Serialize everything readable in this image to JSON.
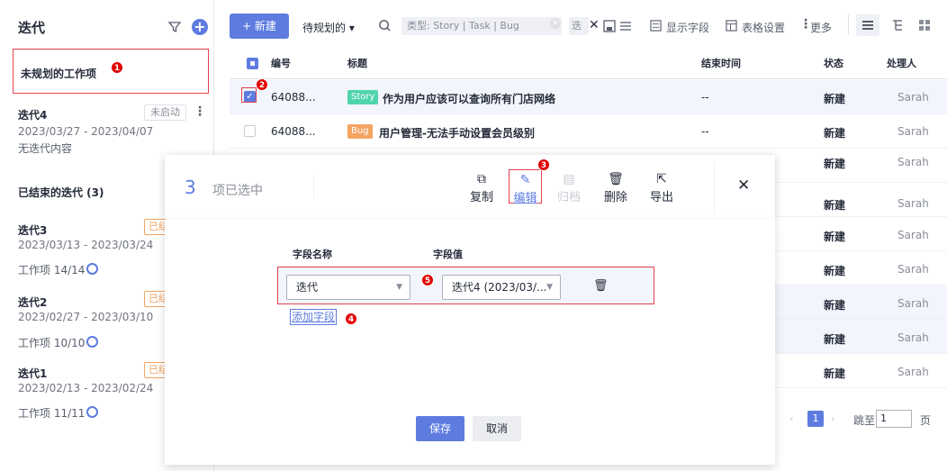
{
  "sidebar": {
    "title": "迭代",
    "unplanned": "未规划的工作项",
    "current": {
      "name": "迭代4",
      "status": "未启动",
      "dates": "2023/03/27 - 2023/04/07",
      "desc": "无迭代内容"
    },
    "ended_header": "已结束的迭代 (3)",
    "ended": [
      {
        "name": "迭代3",
        "tag": "已结",
        "dates": "2023/03/13 - 2023/03/24",
        "items": "工作项 14/14"
      },
      {
        "name": "迭代2",
        "tag": "已结",
        "dates": "2023/02/27 - 2023/03/10",
        "items": "工作项 10/10"
      },
      {
        "name": "迭代1",
        "tag": "已结",
        "dates": "2023/02/13 - 2023/02/24",
        "items": "工作项 11/11"
      }
    ]
  },
  "toolbar": {
    "new_label": "+ 新建",
    "dropdown_label": "待规划的 ▾",
    "filter_chip": "类型: Story | Task | Bug",
    "filter_more": "迭",
    "show_fields": "显示字段",
    "table_settings": "表格设置",
    "more": "更多"
  },
  "table": {
    "headers": [
      "编号",
      "标题",
      "结束时间",
      "状态",
      "处理人"
    ],
    "rows": [
      {
        "id": "64088...",
        "type": "Story",
        "title": "作为用户应该可以查询所有门店网络",
        "end": "--",
        "status": "新建",
        "owner": "Sarah"
      },
      {
        "id": "64088...",
        "type": "Bug",
        "title": "用户管理-无法手动设置会员级别",
        "end": "--",
        "status": "新建",
        "owner": "Sarah"
      },
      {
        "status": "新建",
        "owner": "Sarah"
      },
      {
        "status": "新建",
        "owner": "Sarah"
      },
      {
        "status": "新建",
        "owner": "Sarah"
      },
      {
        "status": "新建",
        "owner": "Sarah"
      },
      {
        "status": "新建",
        "owner": "Sarah"
      },
      {
        "status": "新建",
        "owner": "Sarah"
      },
      {
        "status": "新建",
        "owner": "Sarah"
      }
    ]
  },
  "selection_bar": {
    "count": "3",
    "count_label": "项已选中",
    "actions": {
      "copy": "复制",
      "edit": "编辑",
      "archive": "归档",
      "delete": "删除",
      "export": "导出"
    }
  },
  "edit_panel": {
    "field_name_header": "字段名称",
    "field_value_header": "字段值",
    "field_name_value": "迭代",
    "field_value_value": "迭代4 (2023/03/...",
    "add_field": "添加字段",
    "save": "保存",
    "cancel": "取消"
  },
  "pager": {
    "current_page": "1",
    "jump_label": "跳至",
    "jump_value": "1",
    "page_label": "页"
  },
  "badges": [
    "1",
    "2",
    "3",
    "4",
    "5"
  ],
  "colors": {
    "primary": "#5e7ce0",
    "story": "#50d4ab",
    "bug": "#f3a461",
    "annotation": "#e30000"
  },
  "icons": [
    "filter-icon",
    "add-icon",
    "search-icon",
    "clear-icon",
    "save-view-icon",
    "list-filter-icon",
    "copy-icon",
    "edit-icon",
    "archive-icon",
    "delete-icon",
    "export-icon",
    "close-icon",
    "trash-icon",
    "chevron-down-icon",
    "list-view-icon",
    "tree-view-icon",
    "grid-view-icon"
  ]
}
